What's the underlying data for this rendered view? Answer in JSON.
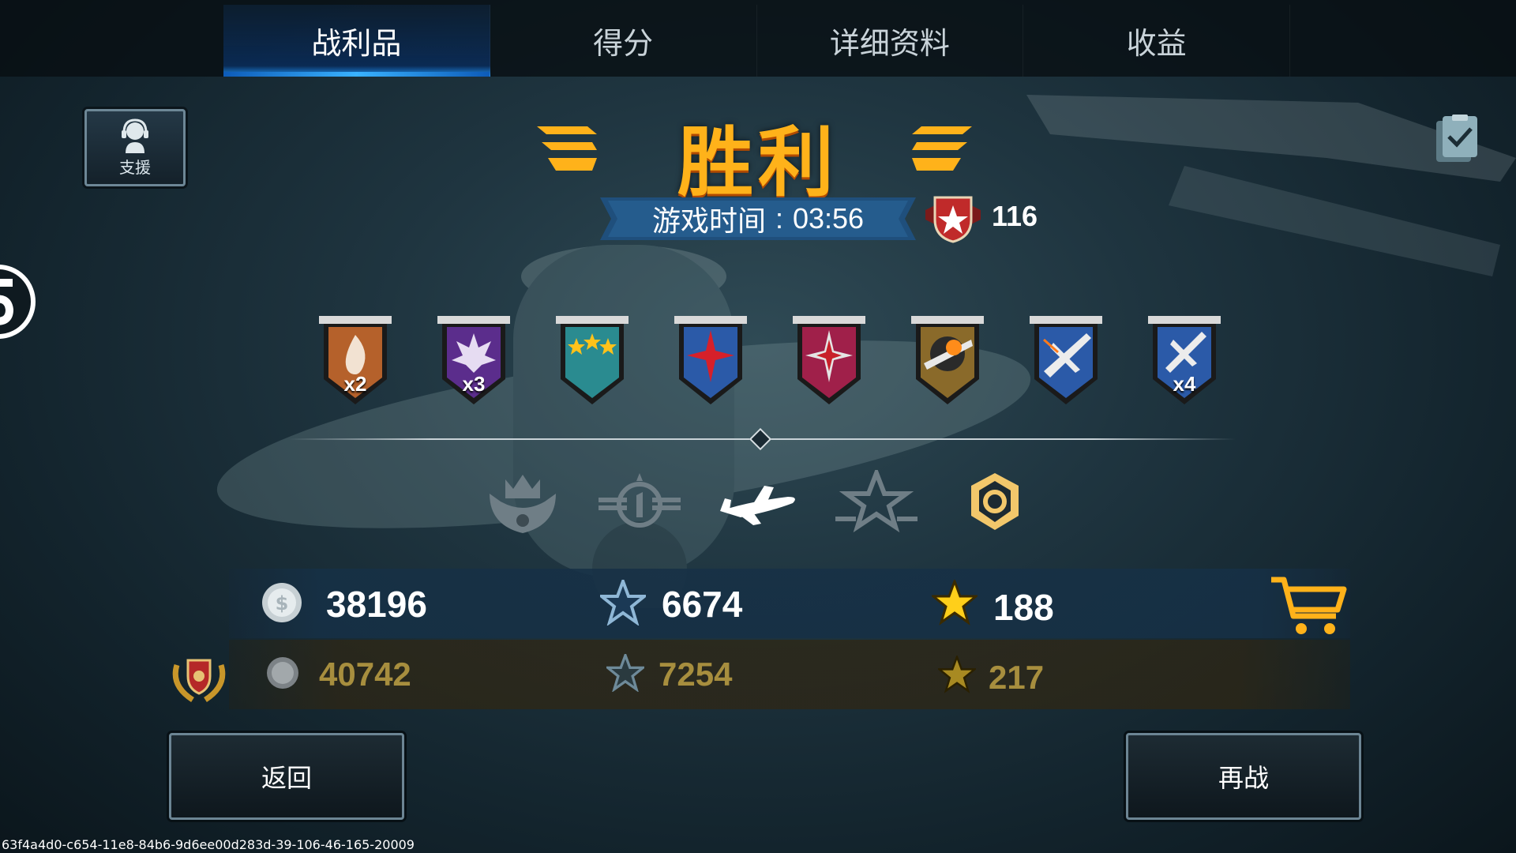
{
  "tabs": [
    {
      "label": "战利品",
      "active": true
    },
    {
      "label": "得分",
      "active": false
    },
    {
      "label": "详细资料",
      "active": false
    },
    {
      "label": "收益",
      "active": false
    }
  ],
  "support": {
    "label": "支援"
  },
  "title": "胜利",
  "match": {
    "time_label": "游戏时间",
    "time_sep": ":",
    "time_value": "03:56",
    "rank_points": "116"
  },
  "medals": [
    {
      "name": "fire-medal",
      "color": "#b5612b",
      "multiplier": "x2"
    },
    {
      "name": "explosion-medal",
      "color": "#5b2d8c",
      "multiplier": "x3"
    },
    {
      "name": "three-stars-medal",
      "color": "#2a8b90",
      "multiplier": ""
    },
    {
      "name": "red-star-blue-medal",
      "color": "#2b5aa8",
      "multiplier": ""
    },
    {
      "name": "red-star-crimson-medal",
      "color": "#a0204a",
      "multiplier": ""
    },
    {
      "name": "crashed-plane-medal",
      "color": "#8a6a2a",
      "multiplier": ""
    },
    {
      "name": "plane-blue-medal",
      "color": "#2b5aa8",
      "multiplier": ""
    },
    {
      "name": "plane-blue-medal-x4",
      "color": "#2b5aa8",
      "multiplier": "x4"
    }
  ],
  "categories": [
    "squadron-crest-icon",
    "rank-wings-icon",
    "aircraft-icon",
    "stars-icon",
    "hex-gear-icon"
  ],
  "rewards": {
    "silver": "38196",
    "experience": "6674",
    "gold_stars": "188"
  },
  "premium_rewards": {
    "silver": "40742",
    "experience": "7254",
    "gold_stars": "217"
  },
  "buttons": {
    "back": "返回",
    "again": "再战"
  },
  "footer_id": "63f4a4d0-c654-11e8-84b6-9d6ee00d283d-39-106-46-165-20009",
  "colors": {
    "accent_blue": "#1d8ff2",
    "title_gold": "#ffb21a",
    "premium_gold": "#a78e3e"
  }
}
